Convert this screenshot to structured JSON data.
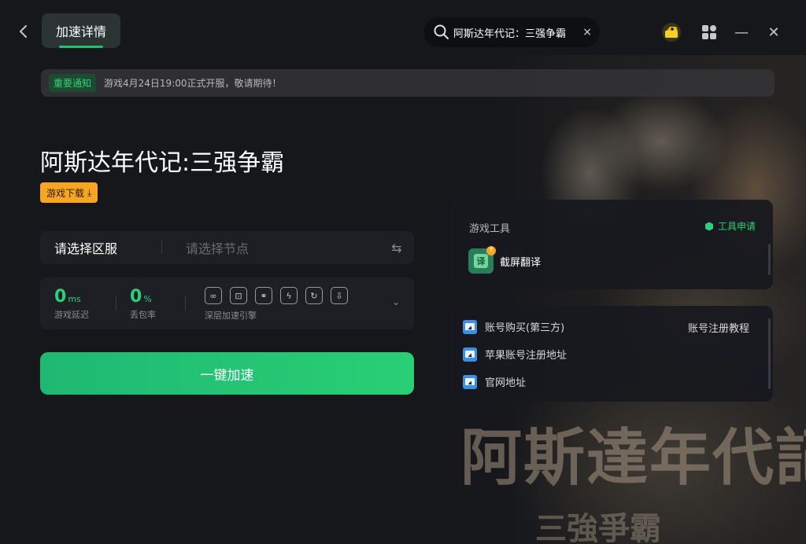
{
  "header": {
    "back_icon": "chevron-left-icon",
    "tab_label": "加速详情",
    "search_text": "阿斯达年代记：三强争霸",
    "search_icon": "search-icon",
    "search_close": "×",
    "gift_icon": "gift-box-icon",
    "apps_icon": "apps-grid-icon",
    "minimize": "—",
    "close": "✕"
  },
  "notice": {
    "badge": "重要通知",
    "text": "游戏4月24日19:00正式开服，敬请期待！"
  },
  "game": {
    "title": "阿斯达年代记:三强争霸",
    "download_label": "游戏下载",
    "download_icon": "⤓"
  },
  "selector": {
    "region_label": "请选择区服",
    "node_placeholder": "请选择节点",
    "swap_icon": "⇆"
  },
  "stats": {
    "latency_value": "0",
    "latency_unit": "ms",
    "latency_label": "游戏延迟",
    "loss_value": "0",
    "loss_unit": "%",
    "loss_label": "丢包率",
    "engine_label": "深层加速引擎",
    "engine_icons": [
      "∞",
      "⊡",
      "⚭",
      "ϟ",
      "↻",
      "⇩"
    ]
  },
  "accelerate_button": "一键加速",
  "tools_panel": {
    "title": "游戏工具",
    "apply_label": "工具申请",
    "items": [
      {
        "name": "截屏翻译",
        "icon_char": "译"
      }
    ]
  },
  "links_panel": {
    "items": [
      {
        "label": "账号购买(第三方)"
      },
      {
        "label": "苹果账号注册地址"
      },
      {
        "label": "官网地址"
      }
    ],
    "right_link": "账号注册教程"
  },
  "background": {
    "title": "阿斯達年代記",
    "subtitle": "三強爭霸"
  },
  "colors": {
    "accent": "#22c26e",
    "download": "#f6a623",
    "link_icon": "#3c8fe8"
  }
}
